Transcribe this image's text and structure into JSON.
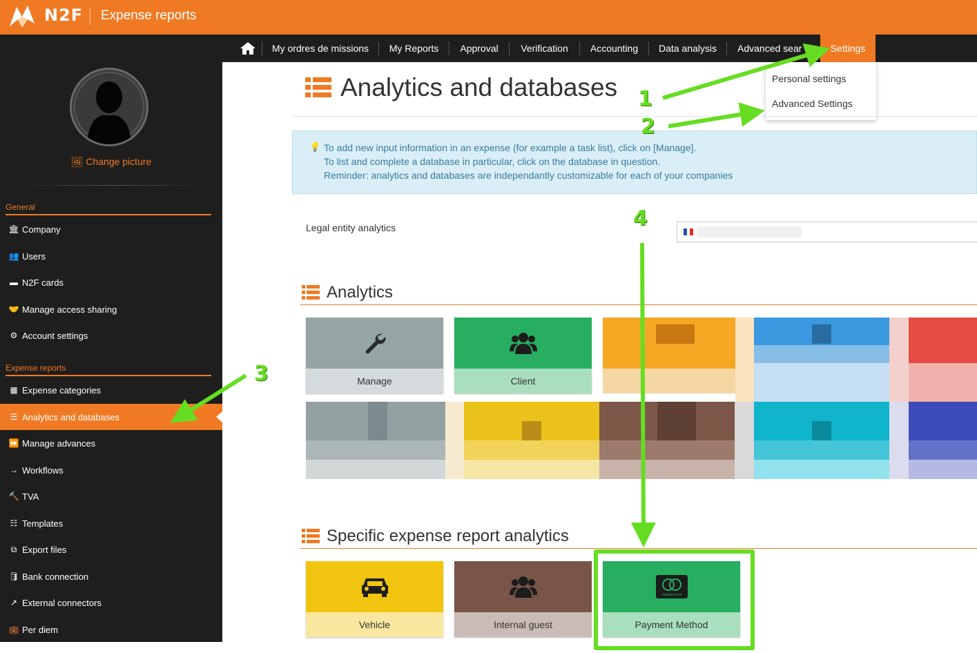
{
  "header": {
    "logo_text": "N2F",
    "app_title": "Expense reports"
  },
  "nav": {
    "items": [
      {
        "label": "My ordres de missions"
      },
      {
        "label": "My Reports"
      },
      {
        "label": "Approval"
      },
      {
        "label": "Verification"
      },
      {
        "label": "Accounting"
      },
      {
        "label": "Data analysis"
      },
      {
        "label": "Advanced sear"
      },
      {
        "label": "Settings"
      }
    ],
    "settings_menu": [
      "Personal settings",
      "Advanced Settings"
    ]
  },
  "sidebar": {
    "change_picture": "Change picture",
    "sections": [
      {
        "title": "General",
        "items": [
          {
            "label": "Company",
            "icon": "bank-icon"
          },
          {
            "label": "Users",
            "icon": "users-icon"
          },
          {
            "label": "N2F cards",
            "icon": "credit-card-icon"
          },
          {
            "label": "Manage access sharing",
            "icon": "handshake-icon"
          },
          {
            "label": "Account settings",
            "icon": "gears-icon"
          }
        ]
      },
      {
        "title": "Expense reports",
        "items": [
          {
            "label": "Expense categories",
            "icon": "grid-icon"
          },
          {
            "label": "Analytics and databases",
            "icon": "list-icon"
          },
          {
            "label": "Manage advances",
            "icon": "fast-forward-icon"
          },
          {
            "label": "Workflows",
            "icon": "arrow-right-icon"
          },
          {
            "label": "TVA",
            "icon": "gavel-icon"
          },
          {
            "label": "Templates",
            "icon": "template-icon"
          },
          {
            "label": "Export files",
            "icon": "copy-icon"
          },
          {
            "label": "Bank connection",
            "icon": "database-icon"
          },
          {
            "label": "External connectors",
            "icon": "external-link-icon"
          },
          {
            "label": "Per diem",
            "icon": "briefcase-icon"
          }
        ]
      }
    ]
  },
  "main": {
    "title": "Analytics and databases",
    "info": [
      "To add new input information in an expense (for example a task list), click on [Manage].",
      "To list and complete a database in particular, click on the database in question.",
      "Reminder: analytics and databases are independantly customizable for each of your companies"
    ],
    "legal_entity_label": "Legal entity analytics",
    "analytics_title": "Analytics",
    "analytics_tiles": [
      {
        "label": "Manage",
        "icon": "wrench-icon"
      },
      {
        "label": "Client",
        "icon": "users-icon"
      }
    ],
    "specific_title": "Specific expense report analytics",
    "specific_tiles": [
      {
        "label": "Vehicle",
        "icon": "car-icon"
      },
      {
        "label": "Internal guest",
        "icon": "users-icon"
      },
      {
        "label": "Payment Method",
        "icon": "mastercard-icon"
      }
    ],
    "mastercard_text": "mastercard"
  },
  "annotations": [
    "1",
    "2",
    "3",
    "4"
  ],
  "colors": {
    "brand_orange": "#f07a23",
    "dark": "#1e1e1e",
    "annotation_green": "#66dd22",
    "grey_tile": "#95a5a6",
    "green_tile": "#27ae60",
    "yellow_tile": "#f1c40f",
    "brown_tile": "#795548"
  }
}
